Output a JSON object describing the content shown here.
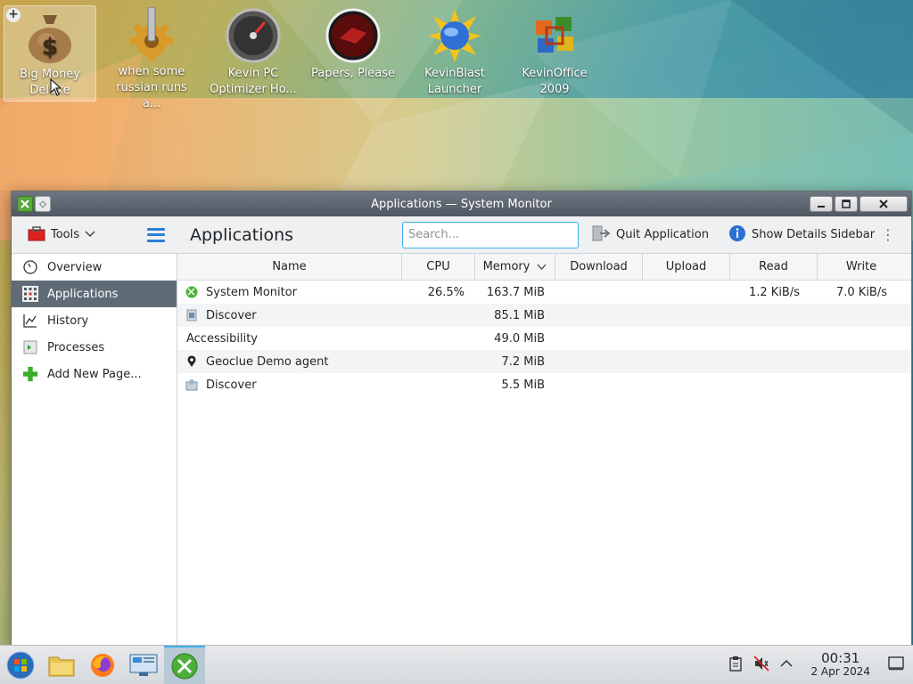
{
  "desktop": {
    "icons": [
      {
        "label": "Big Money Deluxe"
      },
      {
        "label": "when some russian runs a..."
      },
      {
        "label": "Kevin PC Optimizer Ho..."
      },
      {
        "label": "Papers, Please"
      },
      {
        "label": "KevinBlast Launcher"
      },
      {
        "label": "KevinOffice 2009"
      }
    ]
  },
  "window": {
    "title": "Applications — System Monitor",
    "toolbar": {
      "tools_label": "Tools",
      "page_title": "Applications",
      "search_placeholder": "Search...",
      "quit_label": "Quit Application",
      "details_label": "Show Details Sidebar"
    },
    "sidebar": {
      "items": [
        {
          "label": "Overview"
        },
        {
          "label": "Applications"
        },
        {
          "label": "History"
        },
        {
          "label": "Processes"
        },
        {
          "label": "Add New Page..."
        }
      ]
    },
    "table": {
      "headers": [
        "Name",
        "CPU",
        "Memory",
        "Download",
        "Upload",
        "Read",
        "Write"
      ],
      "rows": [
        {
          "name": "System Monitor",
          "cpu": "26.5%",
          "memory": "163.7 MiB",
          "download": "",
          "upload": "",
          "read": "1.2 KiB/s",
          "write": "7.0 KiB/s"
        },
        {
          "name": "Discover",
          "cpu": "",
          "memory": "85.1 MiB",
          "download": "",
          "upload": "",
          "read": "",
          "write": ""
        },
        {
          "name": "Accessibility",
          "cpu": "",
          "memory": "49.0 MiB",
          "download": "",
          "upload": "",
          "read": "",
          "write": ""
        },
        {
          "name": "Geoclue Demo agent",
          "cpu": "",
          "memory": "7.2 MiB",
          "download": "",
          "upload": "",
          "read": "",
          "write": ""
        },
        {
          "name": "Discover",
          "cpu": "",
          "memory": "5.5 MiB",
          "download": "",
          "upload": "",
          "read": "",
          "write": ""
        }
      ]
    }
  },
  "taskbar": {
    "clock_time": "00:31",
    "clock_date": "2 Apr 2024"
  },
  "colors": {
    "accent": "#3daee9",
    "sidebar_active": "#5f6b77"
  }
}
